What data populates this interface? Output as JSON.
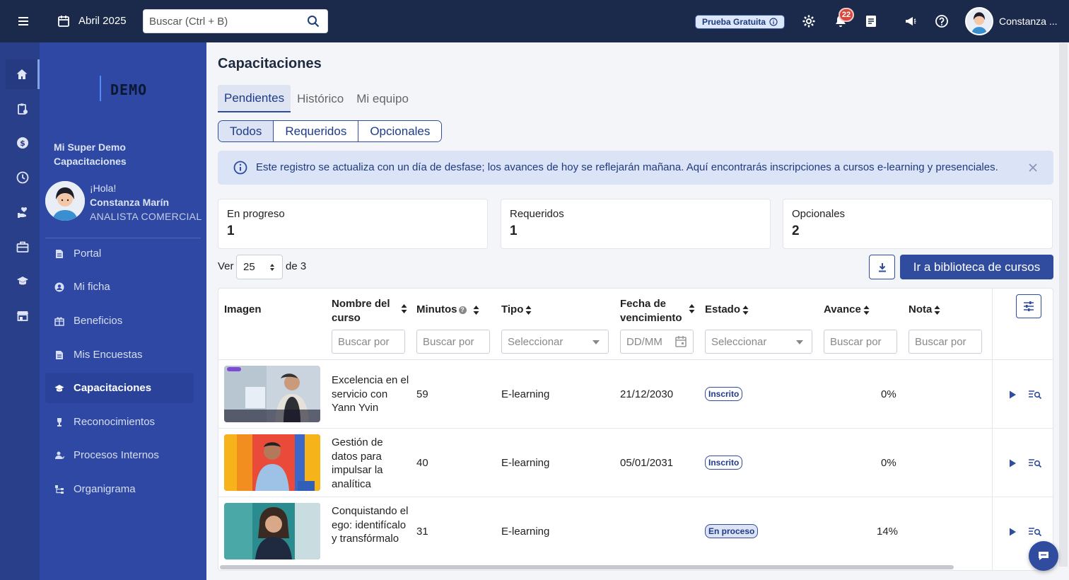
{
  "topbar": {
    "date": "Abril 2025",
    "search_placeholder": "Buscar (Ctrl + B)",
    "trial_label": "Prueba Gratuita",
    "notifications_count": "22",
    "user_name": "Constanza ..."
  },
  "sidebar": {
    "brand": "DEMO",
    "company": "Mi Super Demo Capacitaciones",
    "greeting": "¡Hola!",
    "user_full_name": "Constanza Marín",
    "user_role": "ANALISTA COMERCIAL",
    "items": [
      {
        "label": "Portal",
        "icon": "document-icon"
      },
      {
        "label": "Mi ficha",
        "icon": "user-circle-icon"
      },
      {
        "label": "Beneficios",
        "icon": "gift-icon"
      },
      {
        "label": "Mis Encuestas",
        "icon": "document-icon"
      },
      {
        "label": "Capacitaciones",
        "icon": "graduation-cap-icon",
        "active": true
      },
      {
        "label": "Reconocimientos",
        "icon": "trophy-icon"
      },
      {
        "label": "Procesos Internos",
        "icon": "user-process-icon"
      },
      {
        "label": "Organigrama",
        "icon": "org-chart-icon"
      }
    ]
  },
  "main": {
    "title": "Capacitaciones",
    "tabs": [
      "Pendientes",
      "Histórico",
      "Mi equipo"
    ],
    "active_tab": "Pendientes",
    "filters": [
      "Todos",
      "Requeridos",
      "Opcionales"
    ],
    "active_filter": "Todos",
    "alert_text": "Este registro se actualiza con un día de desfase; los avances de hoy se reflejarán mañana. Aquí encontrarás inscripciones a cursos e-learning y presenciales.",
    "cards": [
      {
        "label": "En progreso",
        "value": "1"
      },
      {
        "label": "Requeridos",
        "value": "1"
      },
      {
        "label": "Opcionales",
        "value": "2"
      }
    ],
    "pager": {
      "ver": "Ver",
      "page_size": "25",
      "of_label": "de 3"
    },
    "library_button": "Ir a biblioteca de cursos"
  },
  "table": {
    "headers": {
      "image": "Imagen",
      "name": "Nombre del curso",
      "minutes": "Minutos",
      "type": "Tipo",
      "due": "Fecha de vencimiento",
      "status": "Estado",
      "progress": "Avance",
      "grade": "Nota"
    },
    "filters": {
      "name": "Buscar por",
      "minutes": "Buscar por",
      "type": "Seleccionar",
      "due": "DD/MM",
      "status": "Seleccionar",
      "progress": "Buscar por",
      "grade": "Buscar por"
    },
    "rows": [
      {
        "name": "Excelencia en el servicio con Yann Yvin",
        "minutes": "59",
        "type": "E-learning",
        "due": "21/12/2030",
        "status": "Inscrito",
        "progress": "0%",
        "grade": ""
      },
      {
        "name": "Gestión de datos para impulsar la analítica",
        "minutes": "40",
        "type": "E-learning",
        "due": "05/01/2031",
        "status": "Inscrito",
        "progress": "0%",
        "grade": ""
      },
      {
        "name": "Conquistando el ego: identifícalo y transfórmalo",
        "minutes": "31",
        "type": "E-learning",
        "due": "",
        "status": "En proceso",
        "progress": "14%",
        "grade": ""
      }
    ]
  },
  "colors": {
    "topbar": "#1b2a4a",
    "sidebar": "#2e48a3",
    "accent": "#2f4c9e",
    "badge": "#d7483e"
  }
}
